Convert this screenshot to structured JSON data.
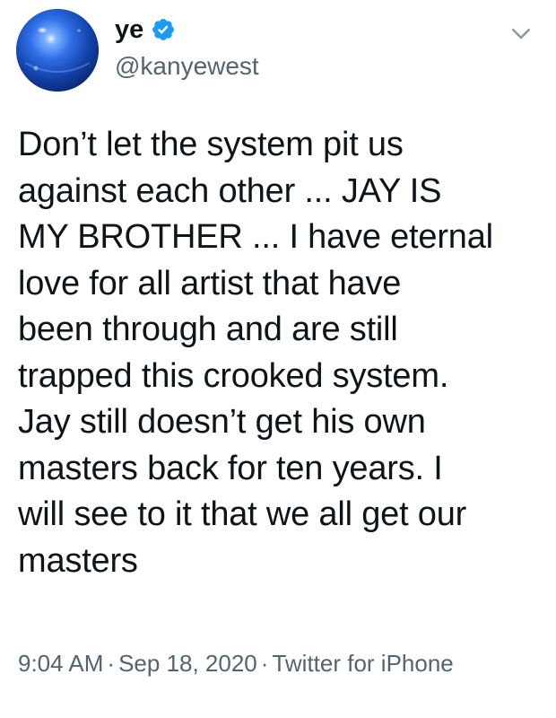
{
  "author": {
    "display_name": "ye",
    "handle": "@kanyewest",
    "verified": true
  },
  "tweet": {
    "text": "Don’t let the system pit us\nagainst each other ... JAY IS\nMY BROTHER ... I have eternal\nlove for all artist that have\nbeen through and are still\ntrapped this crooked system.\nJay still doesn’t get his own\nmasters back for ten years. I\nwill see to it that we all get our\nmasters",
    "time": "9:04 AM",
    "date": "Sep 18, 2020",
    "source": "Twitter for iPhone",
    "separator": "·"
  },
  "icons": {
    "verified": "verified-badge-icon",
    "menu": "chevron-down-icon"
  },
  "colors": {
    "text": "#0f1419",
    "secondary": "#536471",
    "verified_blue": "#1d9bf0",
    "avatar_blue": "#1f4fbf"
  }
}
